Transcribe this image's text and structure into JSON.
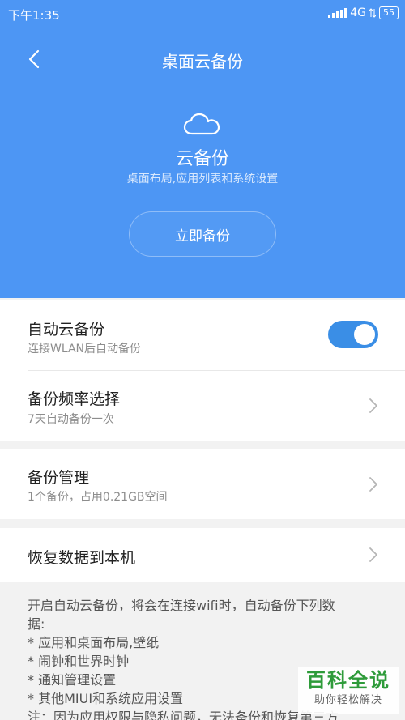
{
  "status": {
    "time": "下午1:35",
    "network": "4G",
    "battery": "55"
  },
  "header": {
    "title": "桌面云备份"
  },
  "hero": {
    "title": "云备份",
    "subtitle": "桌面布局,应用列表和系统设置",
    "button": "立即备份"
  },
  "settings": {
    "auto_backup": {
      "title": "自动云备份",
      "subtitle": "连接WLAN后自动备份",
      "enabled": true
    },
    "frequency": {
      "title": "备份频率选择",
      "subtitle": "7天自动备份一次"
    },
    "manage": {
      "title": "备份管理",
      "subtitle": "1个备份，占用0.21GB空间"
    },
    "restore": {
      "title": "恢复数据到本机"
    }
  },
  "info": {
    "lines": [
      "开启自动云备份，将会在连接wifi时，自动备份下列数",
      "据:",
      "*  应用和桌面布局,壁纸",
      "*  闹钟和世界时钟",
      "*  通知管理设置",
      "*  其他MIUI和系统应用设置",
      "注：因为应用权限与隐私问题，无法备份和恢复第三方"
    ]
  },
  "watermark": {
    "main": "百科全说",
    "sub": "助你轻松解决"
  },
  "colors": {
    "header_bg": "#4d96f4",
    "toggle_on": "#3a8ee6",
    "watermark_green": "#2e9b3a"
  }
}
